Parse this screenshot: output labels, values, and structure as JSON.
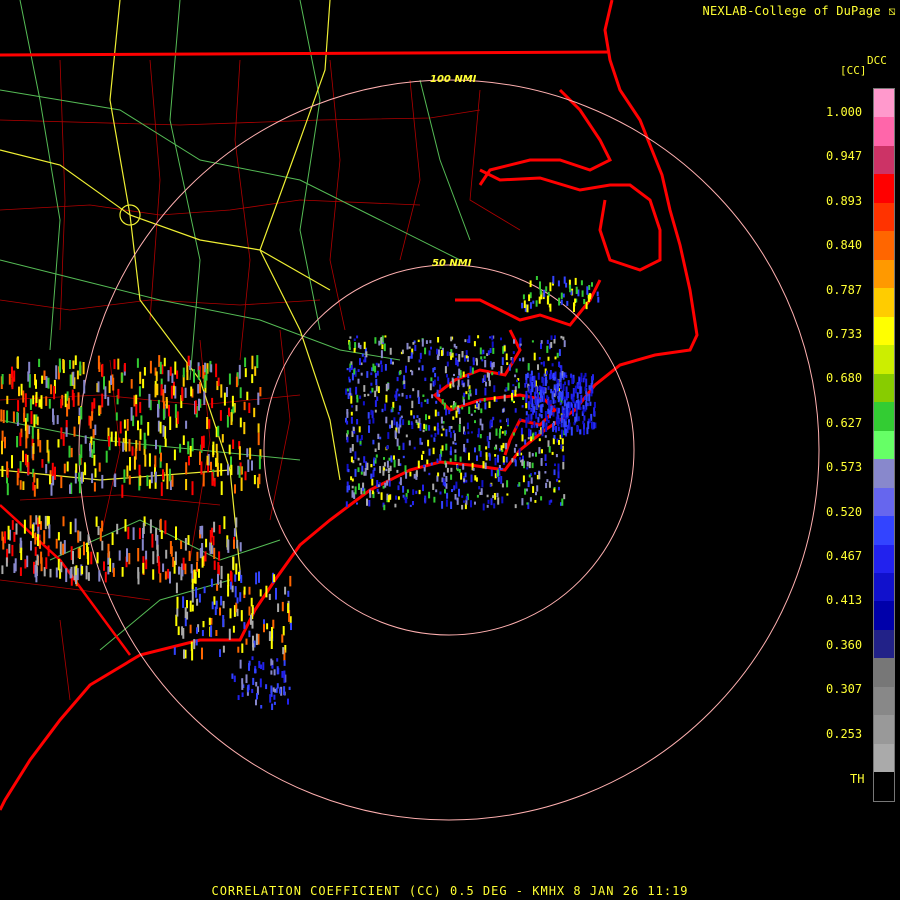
{
  "header": {
    "credit": "NEXLAB-College of DuPage ⧅"
  },
  "legend": {
    "product_code": "DCC",
    "unit": "[CC]",
    "ticks": [
      "1.000",
      "0.947",
      "0.893",
      "0.840",
      "0.787",
      "0.733",
      "0.680",
      "0.627",
      "0.573",
      "0.520",
      "0.467",
      "0.413",
      "0.360",
      "0.307",
      "0.253",
      "TH"
    ],
    "colors": [
      "#ff99cc",
      "#ff66aa",
      "#cc3366",
      "#ff0000",
      "#ff3300",
      "#ff6600",
      "#ff9900",
      "#ffcc00",
      "#ffff00",
      "#ccee00",
      "#88cc00",
      "#33cc33",
      "#66ff66",
      "#8888cc",
      "#6666ee",
      "#3344ff",
      "#2222ee",
      "#1111cc",
      "#0000aa",
      "#222288",
      "#777777",
      "#888888",
      "#999999",
      "#aaaaaa",
      "#000000"
    ]
  },
  "range_rings": {
    "inner_label": "50 NMI",
    "outer_label": "100 NMI"
  },
  "footer": {
    "caption": "CORRELATION COEFFICIENT (CC) 0.5 DEG - KMHX 8 JAN 26 11:19"
  },
  "map_colors": {
    "coast": "#ff0000",
    "county": "#cc0000",
    "highway_major": "#ffff44",
    "highway_minor": "#66cc66",
    "ring": "#ffaaaa"
  }
}
